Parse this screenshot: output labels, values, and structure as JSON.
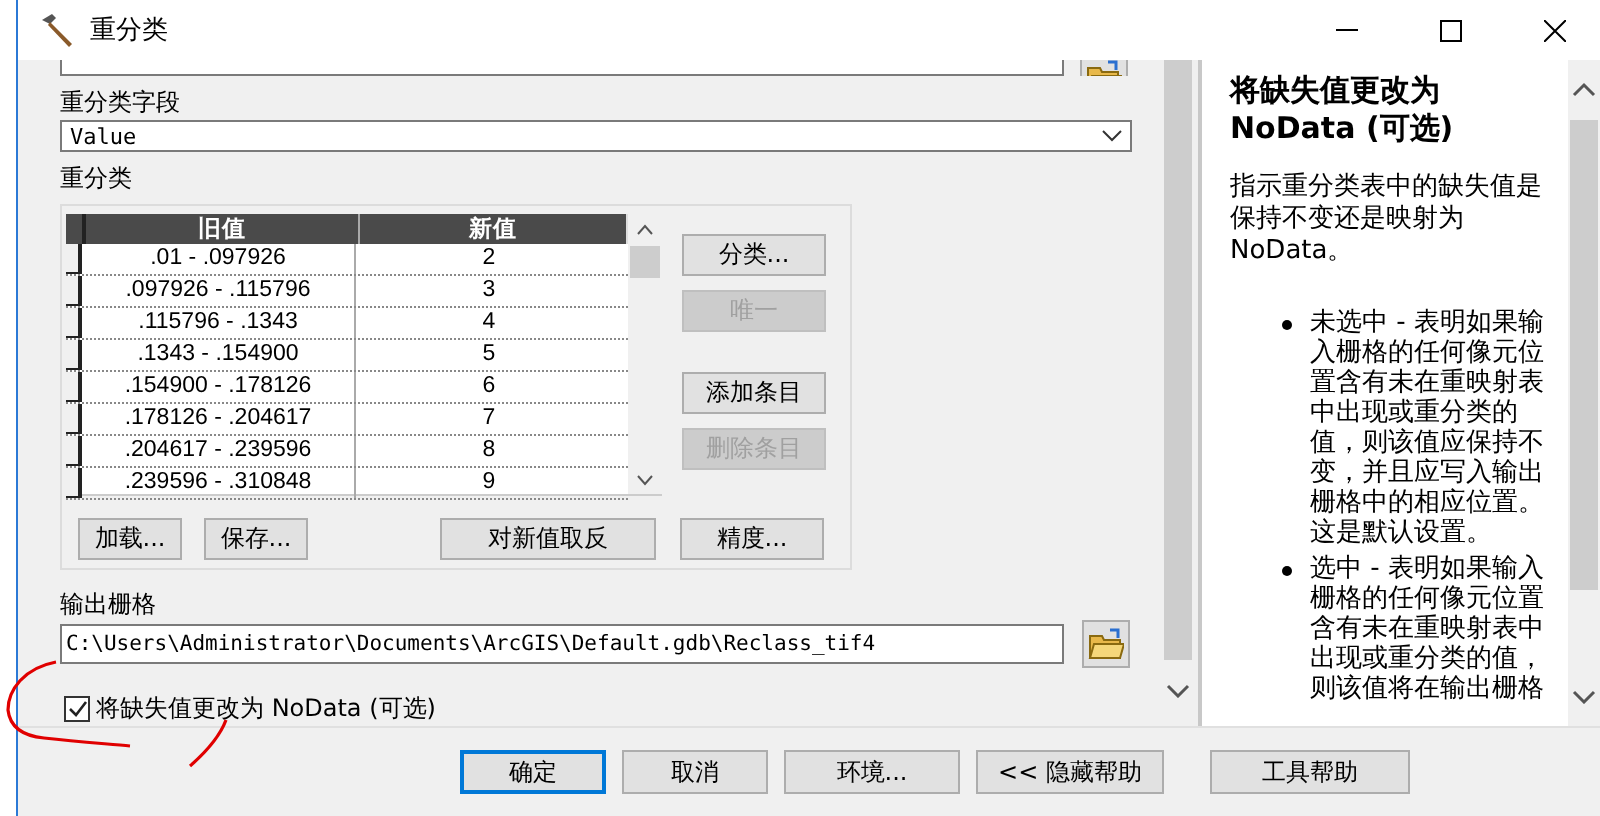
{
  "window": {
    "title": "重分类"
  },
  "reclass_field": {
    "label": "重分类字段",
    "value": "Value"
  },
  "reclassification": {
    "label": "重分类",
    "columns": [
      "旧值",
      "新值"
    ],
    "rows": [
      {
        "old": ".01 - .097926",
        "new": "2"
      },
      {
        "old": ".097926 - .115796",
        "new": "3"
      },
      {
        "old": ".115796 - .1343",
        "new": "4"
      },
      {
        "old": ".1343 - .154900",
        "new": "5"
      },
      {
        "old": ".154900 - .178126",
        "new": "6"
      },
      {
        "old": ".178126 - .204617",
        "new": "7"
      },
      {
        "old": ".204617 - .239596",
        "new": "8"
      },
      {
        "old": ".239596 - .310848",
        "new": "9"
      }
    ],
    "side_buttons": [
      {
        "label": "分类...",
        "disabled": false
      },
      {
        "label": "唯一",
        "disabled": true
      },
      {
        "label": "添加条目",
        "disabled": false
      },
      {
        "label": "删除条目",
        "disabled": true
      }
    ],
    "bottom_buttons": [
      {
        "label": "加载...",
        "kind": "small"
      },
      {
        "label": "保存...",
        "kind": "small"
      },
      {
        "label": "对新值取反",
        "kind": "wide"
      },
      {
        "label": "精度...",
        "kind": "side"
      }
    ]
  },
  "output_raster": {
    "label": "输出栅格",
    "value": "C:\\Users\\Administrator\\Documents\\ArcGIS\\Default.gdb\\Reclass_tif4"
  },
  "nodata_option": {
    "label": "将缺失值更改为 NoData (可选)",
    "checked": true
  },
  "dialog_buttons": [
    {
      "label": "确定",
      "default": true
    },
    {
      "label": "取消",
      "default": false
    },
    {
      "label": "环境...",
      "default": false
    },
    {
      "label": "<< 隐藏帮助",
      "default": false
    },
    {
      "label": "工具帮助",
      "default": false
    }
  ],
  "help": {
    "title": "将缺失值更改为 NoData (可选)",
    "paragraph": "指示重分类表中的缺失值是保持不变还是映射为NoData。",
    "bullets": [
      "未选中 - 表明如果输入栅格的任何像元位置含有未在重映射表中出现或重分类的值，则该值应保持不变，并且应写入输出栅格中的相应位置。这是默认设置。",
      "选中 - 表明如果输入栅格的任何像元位置含有未在重映射表中出现或重分类的值，则该值将在输出栅格"
    ]
  }
}
